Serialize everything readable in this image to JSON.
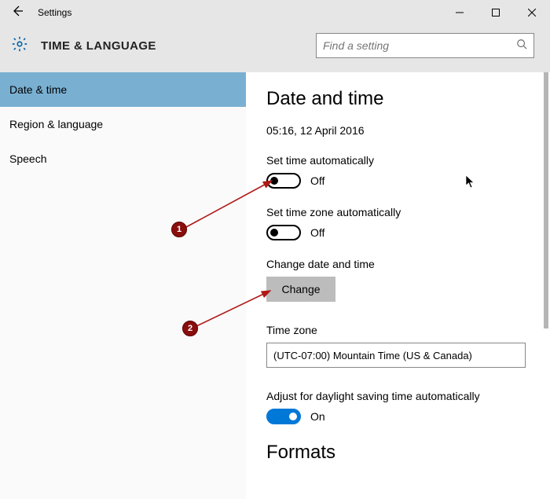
{
  "titlebar": {
    "title": "Settings"
  },
  "header": {
    "section": "TIME & LANGUAGE",
    "search_placeholder": "Find a setting"
  },
  "sidebar": {
    "items": [
      {
        "label": "Date & time",
        "active": true
      },
      {
        "label": "Region & language",
        "active": false
      },
      {
        "label": "Speech",
        "active": false
      }
    ]
  },
  "main": {
    "heading": "Date and time",
    "current_time": "05:16, 12 April 2016",
    "set_time_auto": {
      "label": "Set time automatically",
      "state": "Off",
      "on": false
    },
    "set_tz_auto": {
      "label": "Set time zone automatically",
      "state": "Off",
      "on": false
    },
    "change_dt": {
      "label": "Change date and time",
      "button": "Change"
    },
    "timezone": {
      "label": "Time zone",
      "value": "(UTC-07:00) Mountain Time (US & Canada)"
    },
    "dst": {
      "label": "Adjust for daylight saving time automatically",
      "state": "On",
      "on": true
    },
    "formats_heading": "Formats"
  },
  "annotations": {
    "callouts": [
      "1",
      "2"
    ]
  }
}
